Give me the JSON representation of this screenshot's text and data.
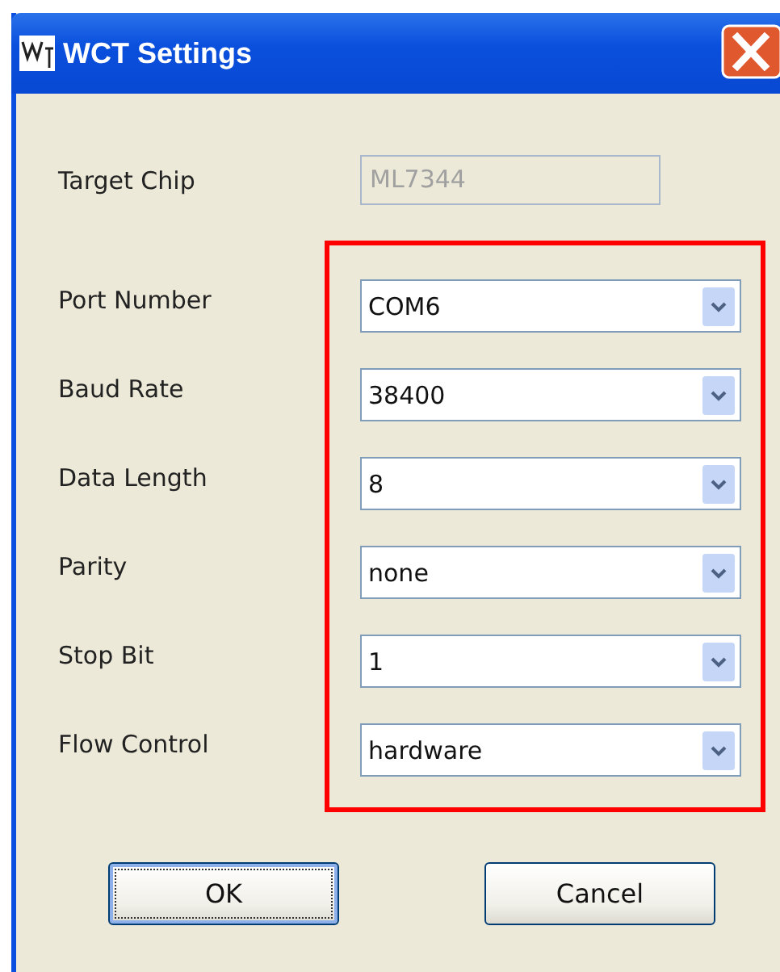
{
  "window": {
    "title": "WCT Settings"
  },
  "target": {
    "label": "Target Chip",
    "value": "ML7344",
    "disabled": true
  },
  "serial_fields": [
    {
      "label": "Port Number",
      "value": "COM6"
    },
    {
      "label": "Baud Rate",
      "value": "38400"
    },
    {
      "label": "Data Length",
      "value": "8"
    },
    {
      "label": "Parity",
      "value": "none"
    },
    {
      "label": "Stop Bit",
      "value": "1"
    },
    {
      "label": "Flow Control",
      "value": "hardware"
    }
  ],
  "buttons": [
    {
      "label": "OK",
      "focused": true
    },
    {
      "label": "Cancel",
      "focused": false
    }
  ]
}
